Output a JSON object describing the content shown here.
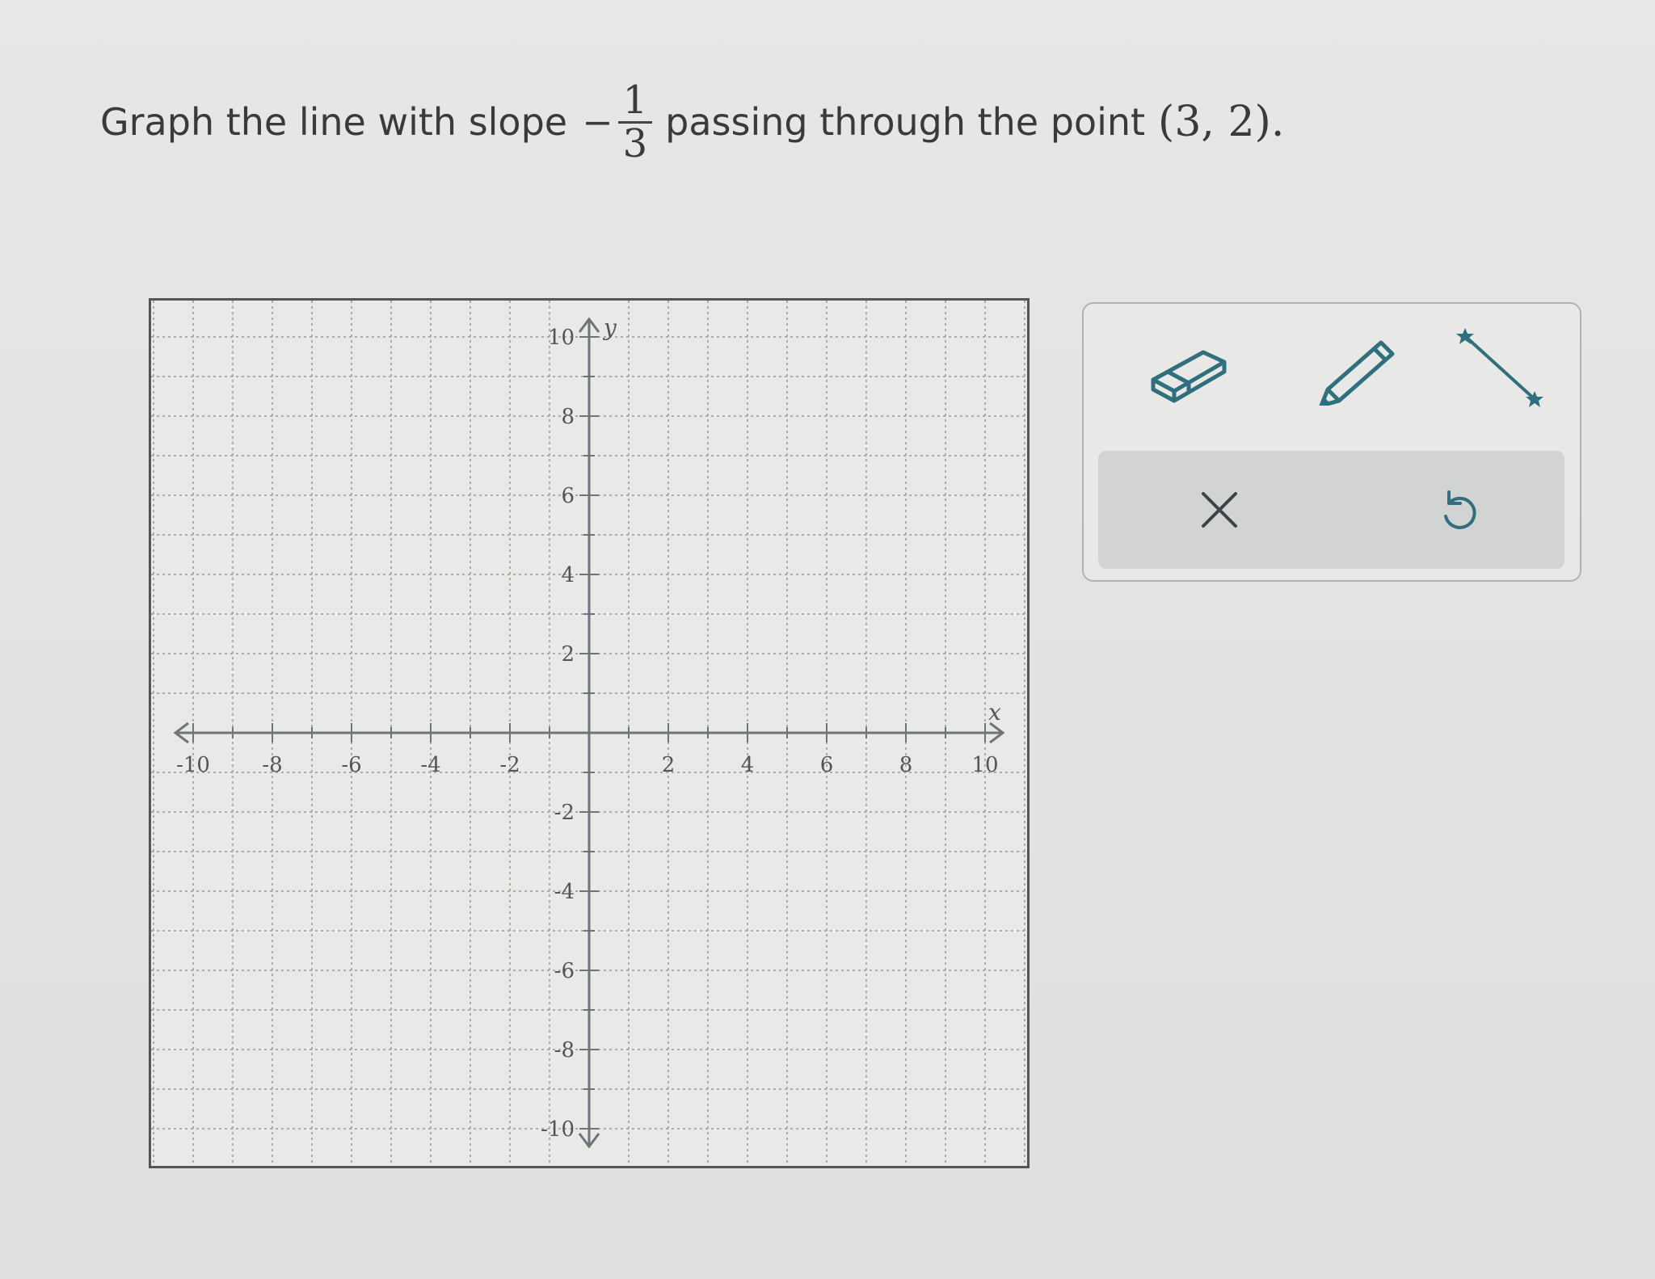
{
  "question": {
    "prefix": "Graph the line with slope",
    "slope_sign": "−",
    "slope_numerator": "1",
    "slope_denominator": "3",
    "middle": "passing through the point",
    "point": "(3, 2).",
    "period": ""
  },
  "graph": {
    "x_axis_label": "x",
    "y_axis_label": "y",
    "x_range": [
      -10,
      10
    ],
    "y_range": [
      -10,
      10
    ],
    "grid_step": 1,
    "x_tick_labels": [
      "-10",
      "-8",
      "-6",
      "-4",
      "-2",
      "2",
      "4",
      "6",
      "8",
      "10"
    ],
    "y_tick_labels": [
      "10",
      "8",
      "6",
      "4",
      "2",
      "-2",
      "-4",
      "-6",
      "-8",
      "-10"
    ]
  },
  "toolbar": {
    "tools": [
      {
        "name": "eraser-tool",
        "icon": "eraser-icon"
      },
      {
        "name": "pencil-tool",
        "icon": "pencil-icon"
      },
      {
        "name": "line-tool",
        "icon": "line-segment-icon"
      }
    ],
    "actions": [
      {
        "name": "clear-button",
        "icon": "close-icon"
      },
      {
        "name": "undo-button",
        "icon": "undo-icon"
      }
    ]
  },
  "colors": {
    "accent": "#2f6f7e",
    "grid": "#a8acae",
    "axis": "#6e7478"
  }
}
